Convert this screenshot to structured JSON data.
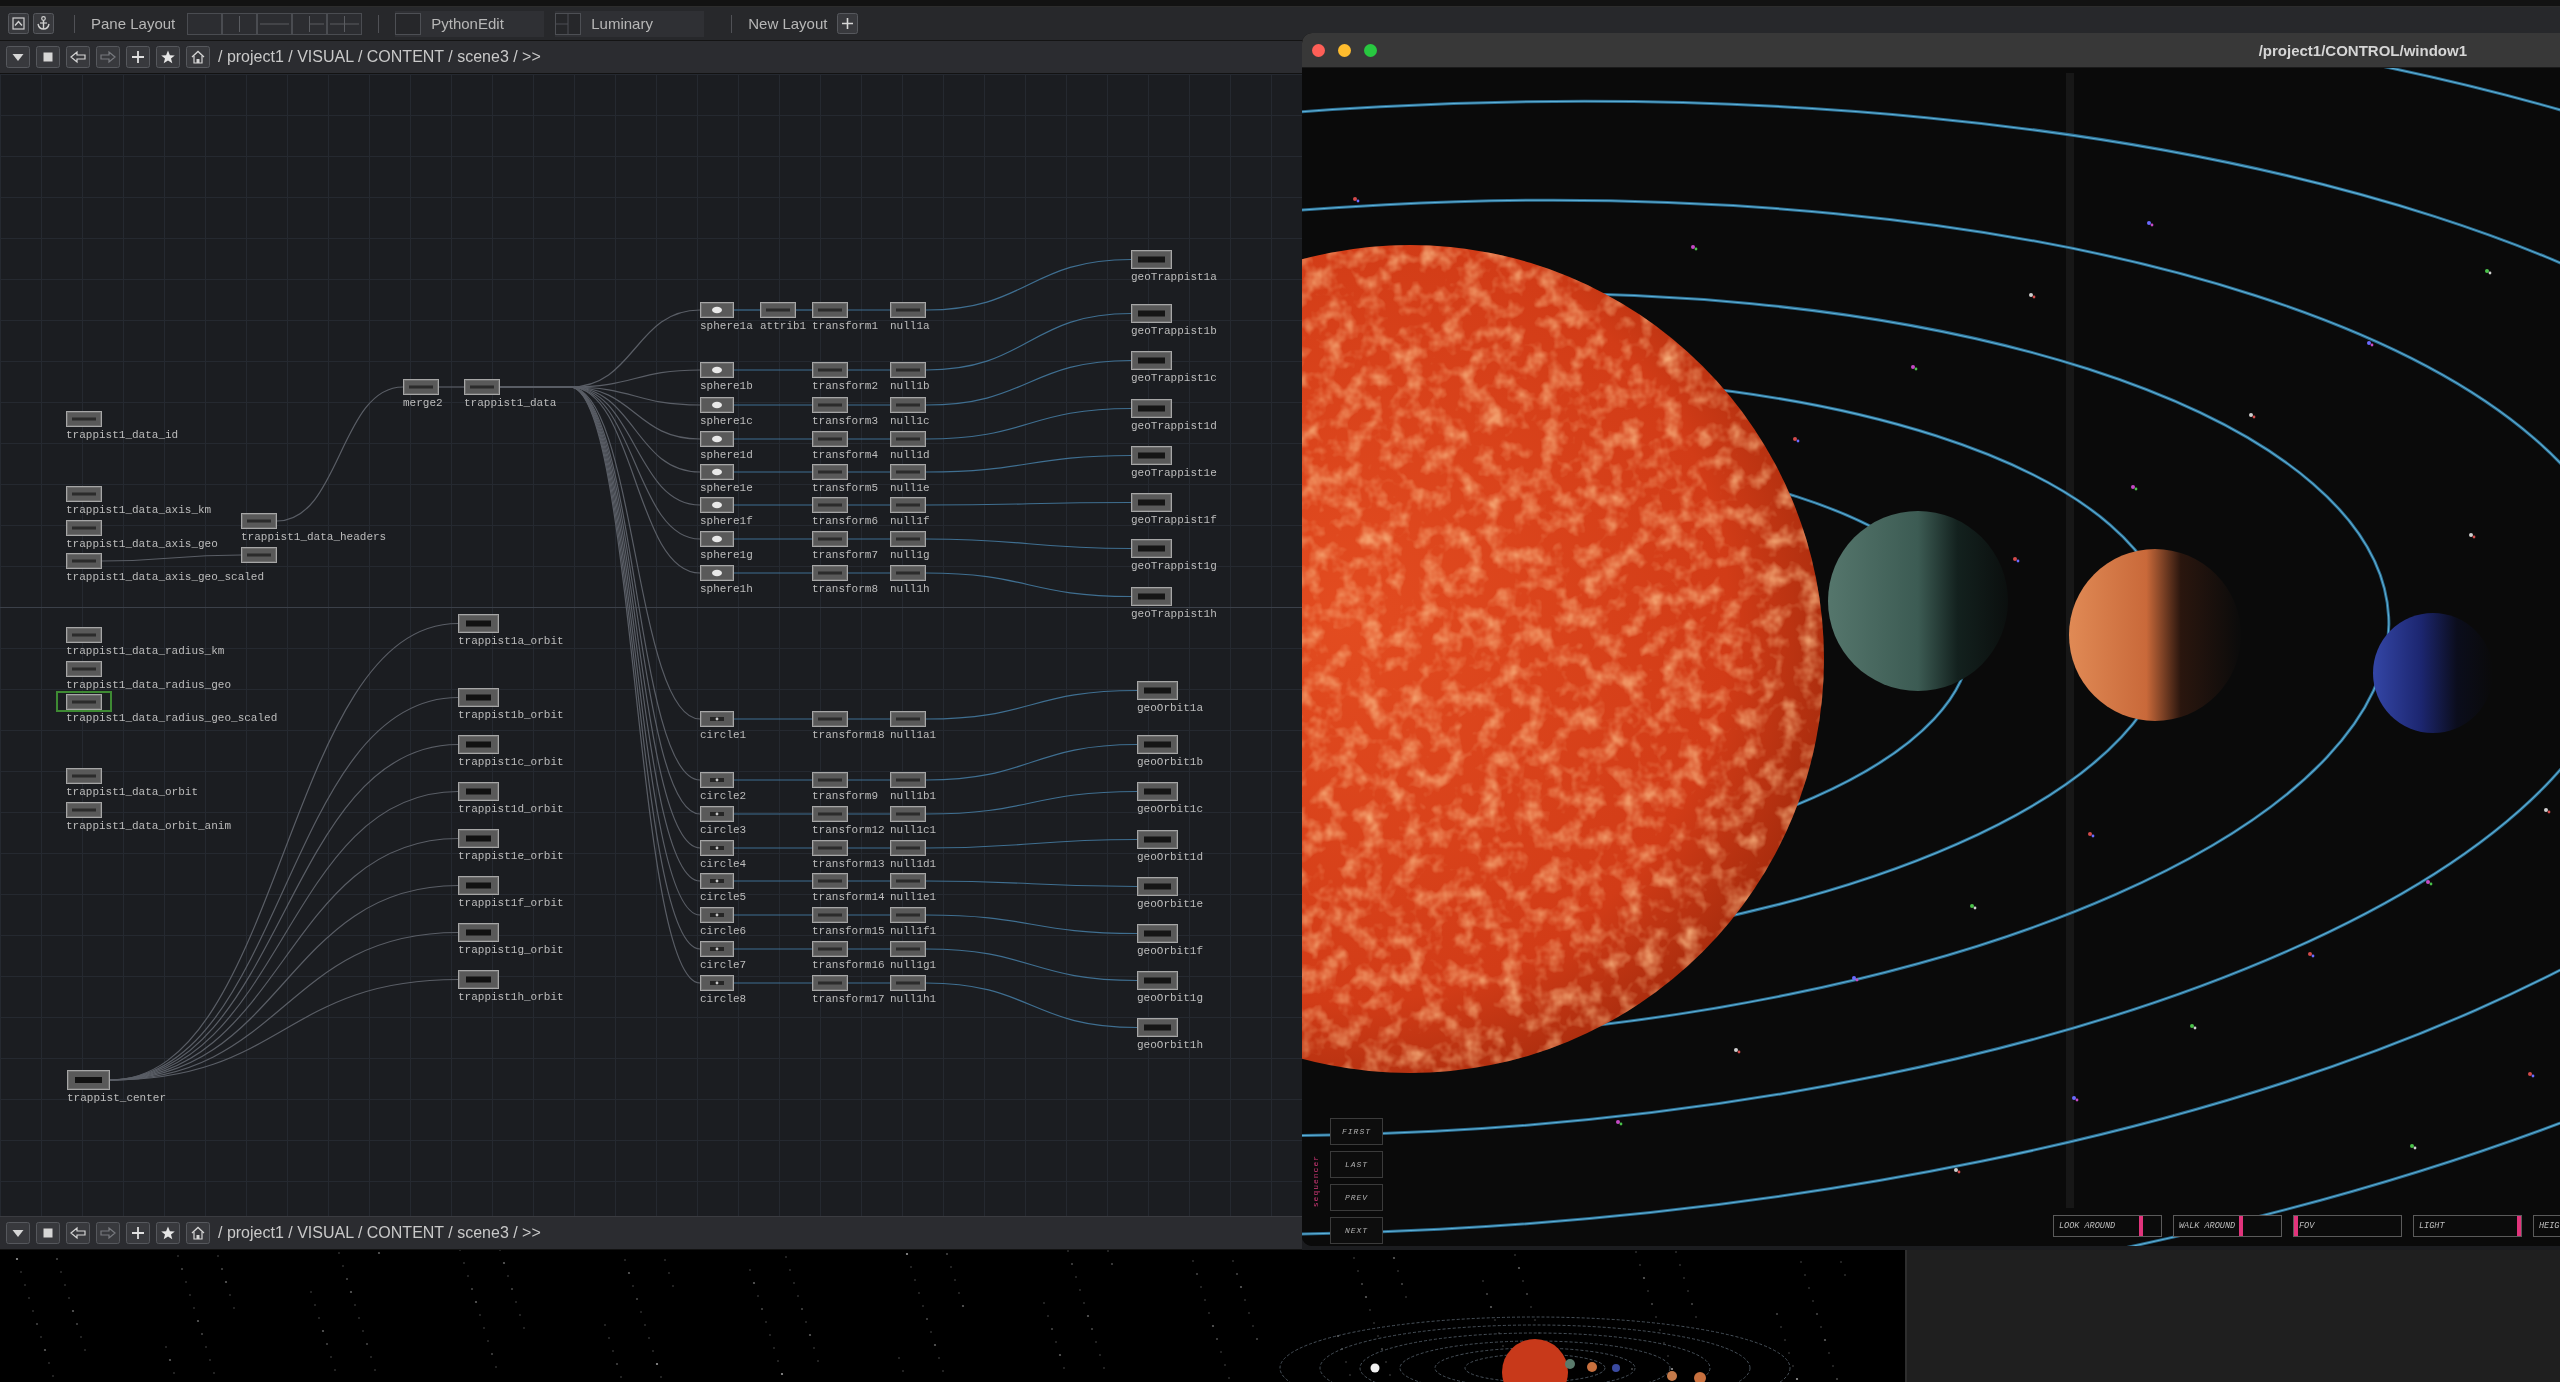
{
  "toolbar": {
    "pane_layout": "Pane Layout",
    "presets": [
      {
        "label": "PythonEdit"
      },
      {
        "label": "Luminary"
      }
    ],
    "new_layout": "New Layout"
  },
  "path_bar": {
    "path": "/ project1 / VISUAL / CONTENT / scene3 / >>"
  },
  "network": {
    "data_groups": [
      [
        {
          "label": "trappist1_data_id",
          "selected": false
        }
      ],
      [
        {
          "label": "trappist1_data_axis_km",
          "selected": false
        },
        {
          "label": "trappist1_data_axis_geo",
          "selected": false
        },
        {
          "label": "trappist1_data_axis_geo_scaled",
          "selected": false
        }
      ],
      [
        {
          "label": "trappist1_data_radius_km",
          "selected": false
        },
        {
          "label": "trappist1_data_radius_geo",
          "selected": false
        },
        {
          "label": "trappist1_data_radius_geo_scaled",
          "selected": true
        }
      ],
      [
        {
          "label": "trappist1_data_orbit",
          "selected": false
        },
        {
          "label": "trappist1_data_orbit_anim",
          "selected": false
        }
      ]
    ],
    "center": {
      "label": "trappist_center",
      "selected": false
    },
    "combine": [
      {
        "label": "trappist1_data_headers",
        "selected": false
      },
      {
        "selected": false
      }
    ],
    "merge": [
      {
        "label": "merge2",
        "selected": false
      },
      {
        "label": "trappist1_data",
        "selected": false
      }
    ],
    "orbits": [
      {
        "label": "trappist1a_orbit",
        "selected": false
      },
      {
        "label": "trappist1b_orbit",
        "selected": false
      },
      {
        "label": "trappist1c_orbit",
        "selected": false
      },
      {
        "label": "trappist1d_orbit",
        "selected": false
      },
      {
        "label": "trappist1e_orbit",
        "selected": false
      },
      {
        "label": "trappist1f_orbit",
        "selected": false
      },
      {
        "label": "trappist1g_orbit",
        "selected": false
      },
      {
        "label": "trappist1h_orbit",
        "selected": false
      }
    ],
    "sphere_rows": [
      {
        "nodes": [
          {
            "label": "sphere1a",
            "selected": false
          },
          {
            "label": "attrib1",
            "selected": false
          },
          {
            "label": "transform1",
            "selected": false
          },
          {
            "label": "null1a",
            "selected": false
          }
        ],
        "output": {
          "label": "geoTrappist1a",
          "selected": false
        }
      },
      {
        "nodes": [
          {
            "label": "sphere1b",
            "selected": false
          },
          {
            "label": "transform2",
            "selected": false
          },
          {
            "label": "null1b",
            "selected": false
          }
        ],
        "output": {
          "label": "geoTrappist1b",
          "selected": false
        }
      },
      {
        "nodes": [
          {
            "label": "sphere1c",
            "selected": false
          },
          {
            "label": "transform3",
            "selected": false
          },
          {
            "label": "null1c",
            "selected": false
          }
        ],
        "output": {
          "label": "geoTrappist1c",
          "selected": false
        }
      },
      {
        "nodes": [
          {
            "label": "sphere1d",
            "selected": false
          },
          {
            "label": "transform4",
            "selected": false
          },
          {
            "label": "null1d",
            "selected": false
          }
        ],
        "output": {
          "label": "geoTrappist1d",
          "selected": false
        }
      },
      {
        "nodes": [
          {
            "label": "sphere1e",
            "selected": false
          },
          {
            "label": "transform5",
            "selected": false
          },
          {
            "label": "null1e",
            "selected": false
          }
        ],
        "output": {
          "label": "geoTrappist1e",
          "selected": false
        }
      },
      {
        "nodes": [
          {
            "label": "sphere1f",
            "selected": false
          },
          {
            "label": "transform6",
            "selected": false
          },
          {
            "label": "null1f",
            "selected": false
          }
        ],
        "output": {
          "label": "geoTrappist1f",
          "selected": false
        }
      },
      {
        "nodes": [
          {
            "label": "sphere1g",
            "selected": false
          },
          {
            "label": "transform7",
            "selected": false
          },
          {
            "label": "null1g",
            "selected": false
          }
        ],
        "output": {
          "label": "geoTrappist1g",
          "selected": false
        }
      },
      {
        "nodes": [
          {
            "label": "sphere1h",
            "selected": false
          },
          {
            "label": "transform8",
            "selected": false
          },
          {
            "label": "null1h",
            "selected": false
          }
        ],
        "output": {
          "label": "geoTrappist1h",
          "selected": false
        }
      }
    ],
    "circle_rows": [
      {
        "nodes": [
          {
            "label": "circle1",
            "selected": false
          },
          {
            "label": "transform18",
            "selected": false
          },
          {
            "label": "null1a1",
            "selected": false
          }
        ],
        "output": {
          "label": "geoOrbit1a",
          "selected": false
        }
      },
      {
        "nodes": [
          {
            "label": "circle2",
            "selected": false
          },
          {
            "label": "transform9",
            "selected": false
          },
          {
            "label": "null1b1",
            "selected": false
          }
        ],
        "output": {
          "label": "geoOrbit1b",
          "selected": false
        }
      },
      {
        "nodes": [
          {
            "label": "circle3",
            "selected": false
          },
          {
            "label": "transform12",
            "selected": false
          },
          {
            "label": "null1c1",
            "selected": false
          }
        ],
        "output": {
          "label": "geoOrbit1c",
          "selected": false
        }
      },
      {
        "nodes": [
          {
            "label": "circle4",
            "selected": false
          },
          {
            "label": "transform13",
            "selected": false
          },
          {
            "label": "null1d1",
            "selected": false
          }
        ],
        "output": {
          "label": "geoOrbit1d",
          "selected": false
        }
      },
      {
        "nodes": [
          {
            "label": "circle5",
            "selected": false
          },
          {
            "label": "transform14",
            "selected": false
          },
          {
            "label": "null1e1",
            "selected": false
          }
        ],
        "output": {
          "label": "geoOrbit1e",
          "selected": false
        }
      },
      {
        "nodes": [
          {
            "label": "circle6",
            "selected": false
          },
          {
            "label": "transform15",
            "selected": false
          },
          {
            "label": "null1f1",
            "selected": false
          }
        ],
        "output": {
          "label": "geoOrbit1f",
          "selected": false
        }
      },
      {
        "nodes": [
          {
            "label": "circle7",
            "selected": false
          },
          {
            "label": "transform16",
            "selected": false
          },
          {
            "label": "null1g1",
            "selected": false
          }
        ],
        "output": {
          "label": "geoOrbit1g",
          "selected": false
        }
      },
      {
        "nodes": [
          {
            "label": "circle8",
            "selected": false
          },
          {
            "label": "transform17",
            "selected": false
          },
          {
            "label": "null1h1",
            "selected": false
          }
        ],
        "output": {
          "label": "geoOrbit1h",
          "selected": false
        }
      }
    ]
  },
  "viewer_window": {
    "title": "/project1/CONTROL/window1",
    "sequencer": {
      "label": "sequencer",
      "buttons": [
        {
          "label": "FIRST"
        },
        {
          "label": "LAST"
        },
        {
          "label": "PREV"
        },
        {
          "label": "NEXT"
        }
      ]
    },
    "sliders": [
      {
        "label": "LOOK AROUND",
        "level": 0.83
      },
      {
        "label": "WALK AROUND",
        "level": 0.63
      },
      {
        "label": "FOV",
        "level": 0
      },
      {
        "label": "LIGHT",
        "level": 1
      },
      {
        "label": "HEIG"
      }
    ]
  },
  "lower_path_bar": {
    "path": "/ project1 / VISUAL / CONTENT / scene3 / >>"
  }
}
